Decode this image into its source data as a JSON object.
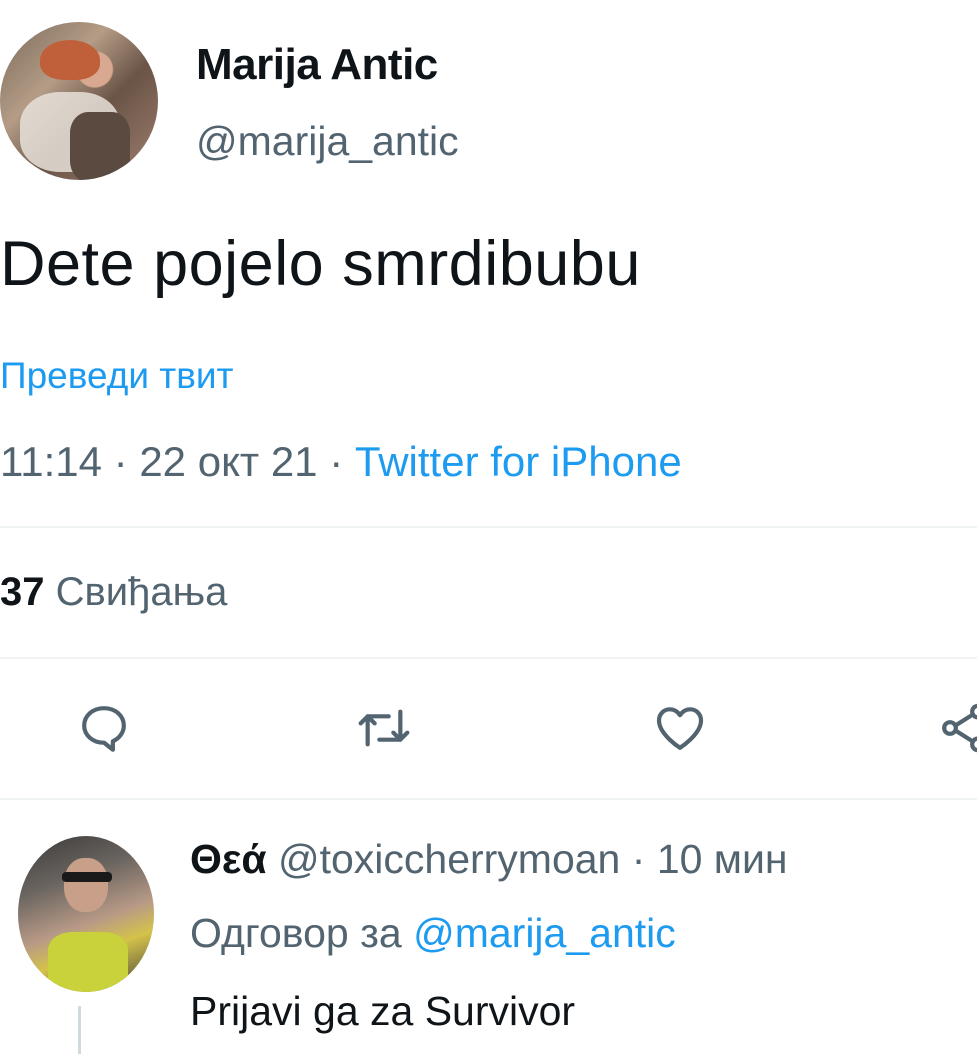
{
  "tweet": {
    "author_name": "Marija Antic",
    "author_handle": "@marija_antic",
    "text": "Dete pojelo smrdibubu",
    "translate_label": "Преведи твит",
    "time": "11:14",
    "separator": " · ",
    "date": "22 окт 21",
    "source": "Twitter for iPhone",
    "likes_count": "37",
    "likes_label": "Свиђања"
  },
  "actions": {
    "reply": "reply-icon",
    "retweet": "retweet-icon",
    "like": "heart-icon",
    "share": "share-icon"
  },
  "reply": {
    "author_name": "Θεά",
    "author_handle": "@toxiccherrymoan",
    "time": "10 мин",
    "replying_prefix": "Одговор за",
    "replying_to": "@marija_antic",
    "text": "Prijavi ga za Survivor"
  },
  "colors": {
    "accent": "#1d9bf0",
    "secondary_text": "#536471",
    "primary_text": "#0f1419"
  }
}
